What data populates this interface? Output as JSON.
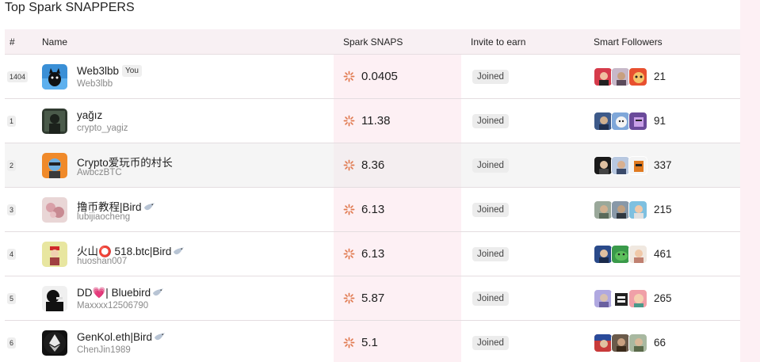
{
  "page": {
    "title": "Top Spark SNAPPERS"
  },
  "table": {
    "headers": {
      "rank": "#",
      "name": "Name",
      "spark": "Spark SNAPS",
      "invite": "Invite to earn",
      "followers": "Smart Followers"
    },
    "rows": [
      {
        "rank": "1404",
        "name": "Web3lbb",
        "badge": "You",
        "handle": "Web3lbb",
        "spark": "0.0405",
        "invite": "Joined",
        "followers": "21",
        "bird": false
      },
      {
        "rank": "1",
        "name": "yağız",
        "handle": "crypto_yagiz",
        "spark": "11.38",
        "invite": "Joined",
        "followers": "91",
        "bird": false
      },
      {
        "rank": "2",
        "name": "Crypto爱玩币的村长",
        "handle": "AwbczBTC",
        "spark": "8.36",
        "invite": "Joined",
        "followers": "337",
        "bird": false
      },
      {
        "rank": "3",
        "name": "撸币教程|Bird",
        "handle": "lubijiaocheng",
        "spark": "6.13",
        "invite": "Joined",
        "followers": "215",
        "bird": true
      },
      {
        "rank": "4",
        "name": "火山⭕ 518.btc|Bird",
        "handle": "huoshan007",
        "spark": "6.13",
        "invite": "Joined",
        "followers": "461",
        "bird": true
      },
      {
        "rank": "5",
        "name": "DD💗| Bluebird",
        "handle": "Maxxxx12506790",
        "spark": "5.87",
        "invite": "Joined",
        "followers": "265",
        "bird": true
      },
      {
        "rank": "6",
        "name": "GenKol.eth|Bird",
        "handle": "ChenJin1989",
        "spark": "5.1",
        "invite": "Joined",
        "followers": "66",
        "bird": true
      }
    ]
  },
  "icons": {
    "spark": "spark-icon",
    "bird": "bird-icon"
  },
  "colors": {
    "accent": "#e07a50",
    "spark_column_bg": "#fdf0f4",
    "header_bg": "#f8f0f3",
    "badge_bg": "#ececec"
  }
}
